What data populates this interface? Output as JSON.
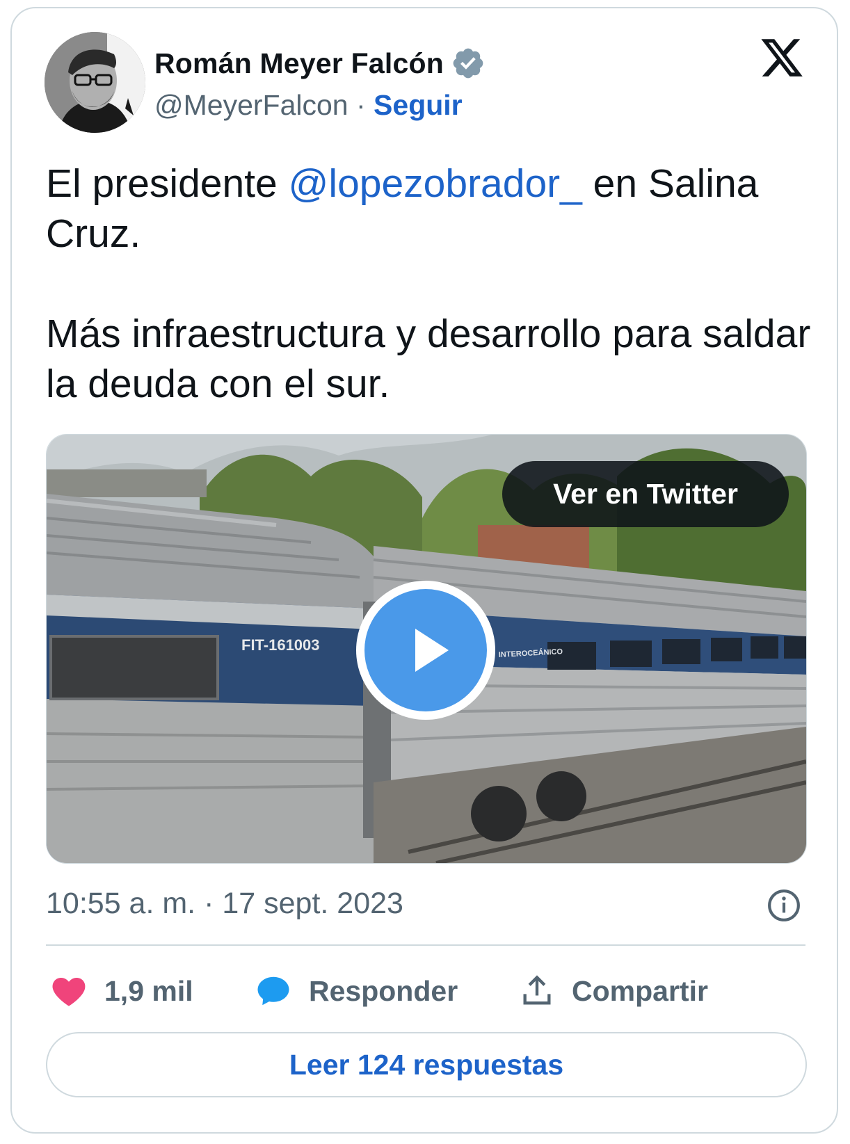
{
  "author": {
    "name": "Román Meyer Falcón",
    "handle": "@MeyerFalcon",
    "separator": "·",
    "follow_label": "Seguir"
  },
  "tweet": {
    "line1_prefix": "El presidente ",
    "mention": "@lopezobrador_",
    "line1_suffix": " en Salina Cruz.",
    "paragraph2": "Más infraestructura y desarrollo para saldar la deuda con el sur."
  },
  "media": {
    "overlay_button": "Ver en Twitter",
    "train_number": "FIT-161003",
    "train_brand": "INTEROCEÁNICO"
  },
  "timestamp": "10:55 a. m. · 17 sept. 2023",
  "actions": {
    "likes": "1,9 mil",
    "reply": "Responder",
    "share": "Compartir"
  },
  "read_replies": "Leer 124 respuestas",
  "colors": {
    "accent": "#1d63c9",
    "like": "#f0447b",
    "reply_bubble": "#1d9bf0",
    "muted": "#536471",
    "border": "#cfd9de"
  },
  "icons": [
    "verified-badge-icon",
    "x-logo-icon",
    "play-icon",
    "info-icon",
    "heart-icon",
    "reply-bubble-icon",
    "share-icon"
  ]
}
